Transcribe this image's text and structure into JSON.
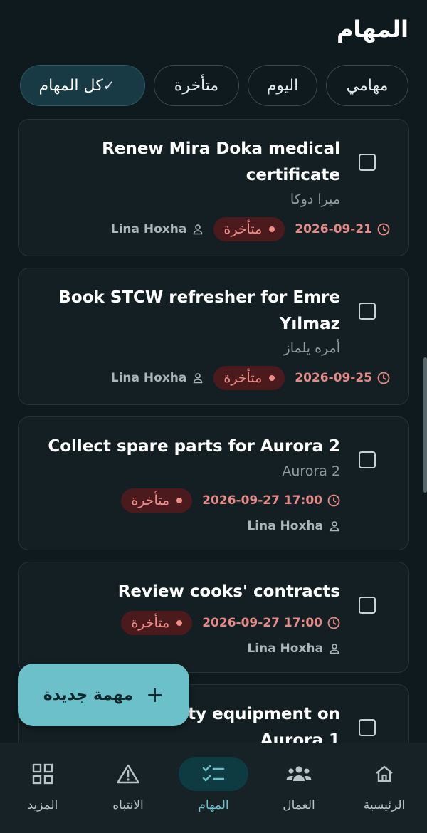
{
  "header": {
    "title": "المهام"
  },
  "filters": [
    {
      "label": "مهامي",
      "selected": false
    },
    {
      "label": "اليوم",
      "selected": false
    },
    {
      "label": "متأخرة",
      "selected": false
    },
    {
      "label": "كل المهام",
      "selected": true
    }
  ],
  "tasks": [
    {
      "title": "Renew Mira Doka medical certificate",
      "subtitle": "ميرا دوكا",
      "due": "2026-09-21",
      "status": "متأخرة",
      "assignee": "Lina Hoxha"
    },
    {
      "title": "Book STCW refresher for Emre Yılmaz",
      "subtitle": "أمره يلماز",
      "due": "2026-09-25",
      "status": "متأخرة",
      "assignee": "Lina Hoxha"
    },
    {
      "title": "Collect spare parts for Aurora 2",
      "subtitle": "Aurora 2",
      "due": "2026-09-27 17:00",
      "status": "متأخرة",
      "assignee": "Lina Hoxha"
    },
    {
      "title": "Review cooks' contracts",
      "due": "2026-09-27 17:00",
      "status": "متأخرة",
      "assignee": "Lina Hoxha"
    },
    {
      "title": "ety equipment on Aurora 1"
    }
  ],
  "fab": {
    "label": "مهمة جديدة"
  },
  "nav": [
    {
      "label": "الرئيسية",
      "icon": "home-icon",
      "active": false
    },
    {
      "label": "العمال",
      "icon": "workers-icon",
      "active": false
    },
    {
      "label": "المهام",
      "icon": "tasks-icon",
      "active": true
    },
    {
      "label": "الانتباه",
      "icon": "warning-icon",
      "active": false
    },
    {
      "label": "المزيد",
      "icon": "grid-icon",
      "active": false
    }
  ],
  "colors": {
    "background": "#0e1a1d",
    "accent": "#6cc0ca",
    "overdue": "#f08d89"
  }
}
